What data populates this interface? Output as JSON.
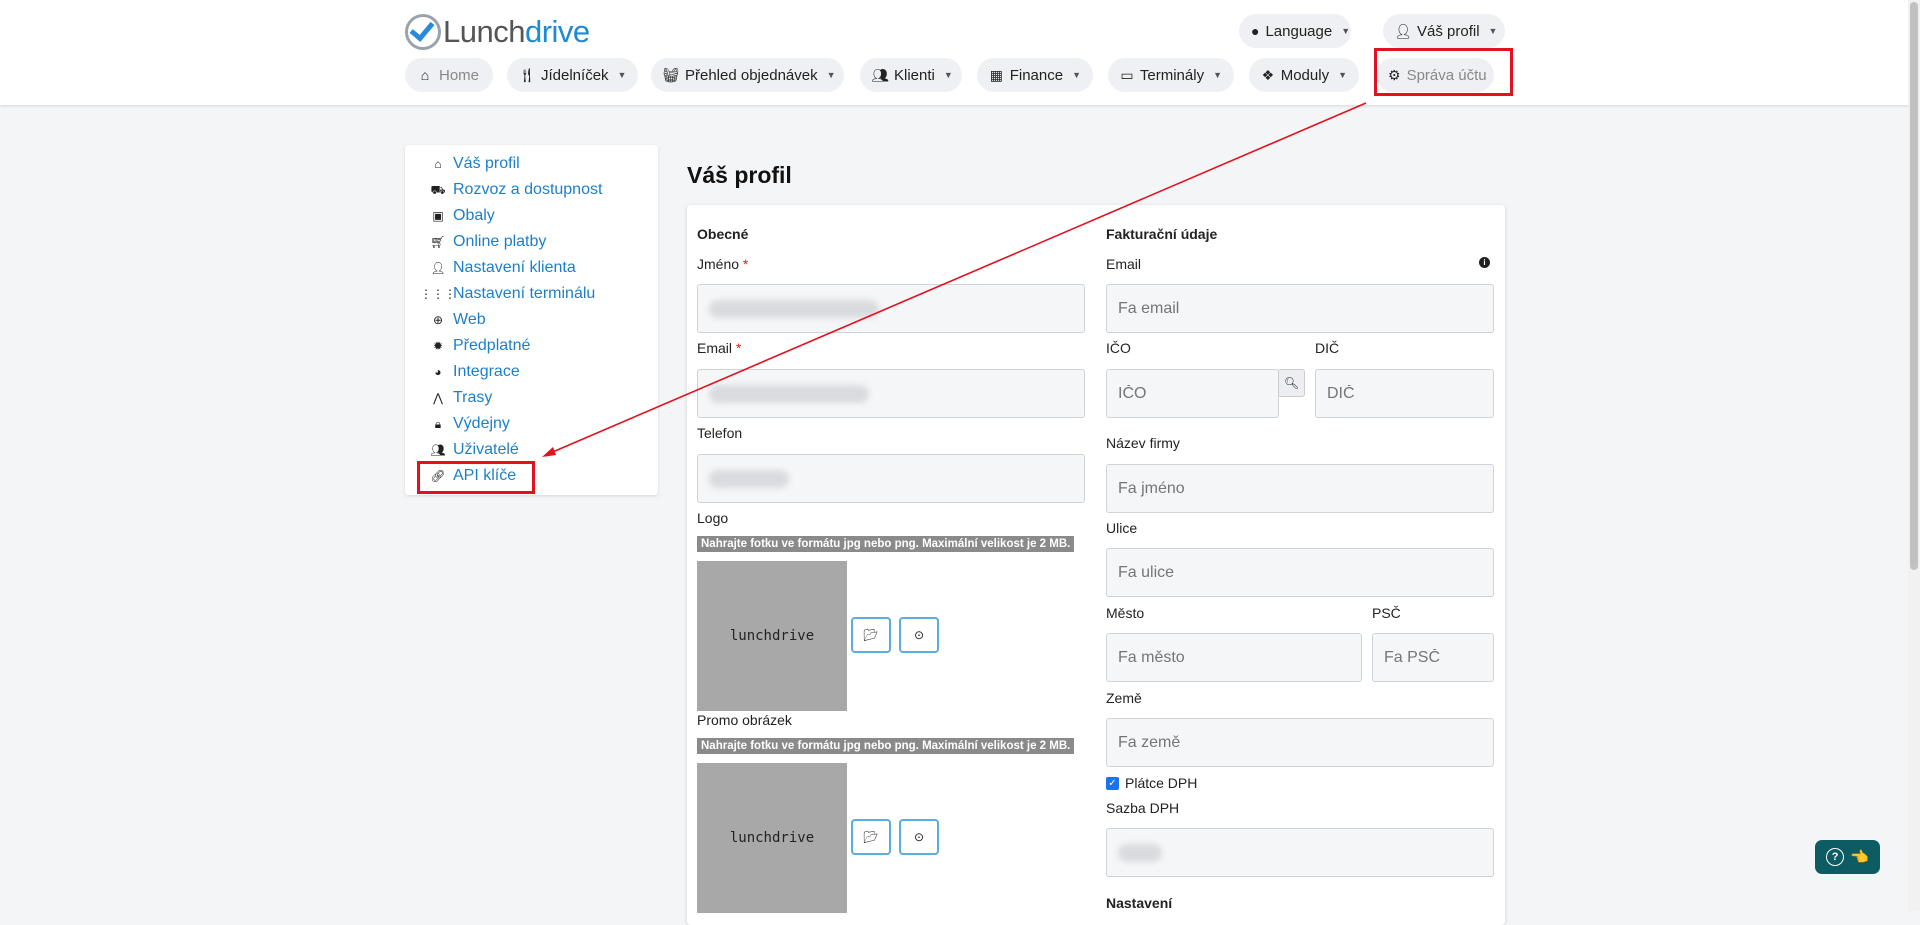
{
  "brand": {
    "part1": "Lunch",
    "part2": "drive"
  },
  "top_right": {
    "language": "Language",
    "profile": "Váš profil"
  },
  "nav": [
    {
      "label": "Home",
      "icon": "home-icon",
      "dropdown": false
    },
    {
      "label": "Jídelníček",
      "icon": "utensils-icon",
      "dropdown": true
    },
    {
      "label": "Přehled objednávek",
      "icon": "basket-icon",
      "dropdown": true
    },
    {
      "label": "Klienti",
      "icon": "users-icon",
      "dropdown": true
    },
    {
      "label": "Finance",
      "icon": "cash-register-icon",
      "dropdown": true
    },
    {
      "label": "Terminály",
      "icon": "terminal-icon",
      "dropdown": true
    },
    {
      "label": "Moduly",
      "icon": "cubes-icon",
      "dropdown": true
    },
    {
      "label": "Správa účtu",
      "icon": "gear-icon",
      "dropdown": false
    }
  ],
  "sidebar": {
    "items": [
      {
        "label": "Váš profil",
        "icon": "home-icon"
      },
      {
        "label": "Rozvoz a dostupnost",
        "icon": "truck-icon"
      },
      {
        "label": "Obaly",
        "icon": "gift-icon"
      },
      {
        "label": "Online platby",
        "icon": "cart-icon"
      },
      {
        "label": "Nastavení klienta",
        "icon": "user-icon"
      },
      {
        "label": "Nastavení terminálu",
        "icon": "grid-icon"
      },
      {
        "label": "Web",
        "icon": "globe-icon"
      },
      {
        "label": "Předplatné",
        "icon": "certificate-icon"
      },
      {
        "label": "Integrace",
        "icon": "globe-americas-icon"
      },
      {
        "label": "Trasy",
        "icon": "road-icon"
      },
      {
        "label": "Výdejny",
        "icon": "lock-icon"
      },
      {
        "label": "Uživatelé",
        "icon": "users-icon"
      },
      {
        "label": "API klíče",
        "icon": "link-icon"
      }
    ]
  },
  "page": {
    "title": "Váš profil"
  },
  "general": {
    "heading": "Obecné",
    "name_label": "Jméno",
    "email_label": "Email",
    "phone_label": "Telefon",
    "required_mark": "*",
    "logo_label": "Logo",
    "promo_label": "Promo obrázek",
    "upload_hint": "Nahrajte fotku ve formátu jpg nebo png. Maximální velikost je 2 MB.",
    "image_placeholder": "lunchdrive"
  },
  "billing": {
    "heading": "Fakturační údaje",
    "email_label": "Email",
    "email_placeholder": "Fa email",
    "ico_label": "IČO",
    "ico_placeholder": "IČO",
    "dic_label": "DIČ",
    "dic_placeholder": "DIČ",
    "company_label": "Název firmy",
    "company_placeholder": "Fa jméno",
    "street_label": "Ulice",
    "street_placeholder": "Fa ulice",
    "city_label": "Město",
    "city_placeholder": "Fa město",
    "zip_label": "PSČ",
    "zip_placeholder": "Fa PSČ",
    "country_label": "Země",
    "country_placeholder": "Fa země",
    "vat_payer_label": "Plátce DPH",
    "vat_payer_checked": true,
    "vat_rate_label": "Sazba DPH",
    "settings_heading": "Nastavení"
  },
  "help": {
    "hand": "👈"
  },
  "colors": {
    "accent": "#1d8ad4",
    "highlight": "#e3101e",
    "help_bg": "#0d5c63"
  }
}
